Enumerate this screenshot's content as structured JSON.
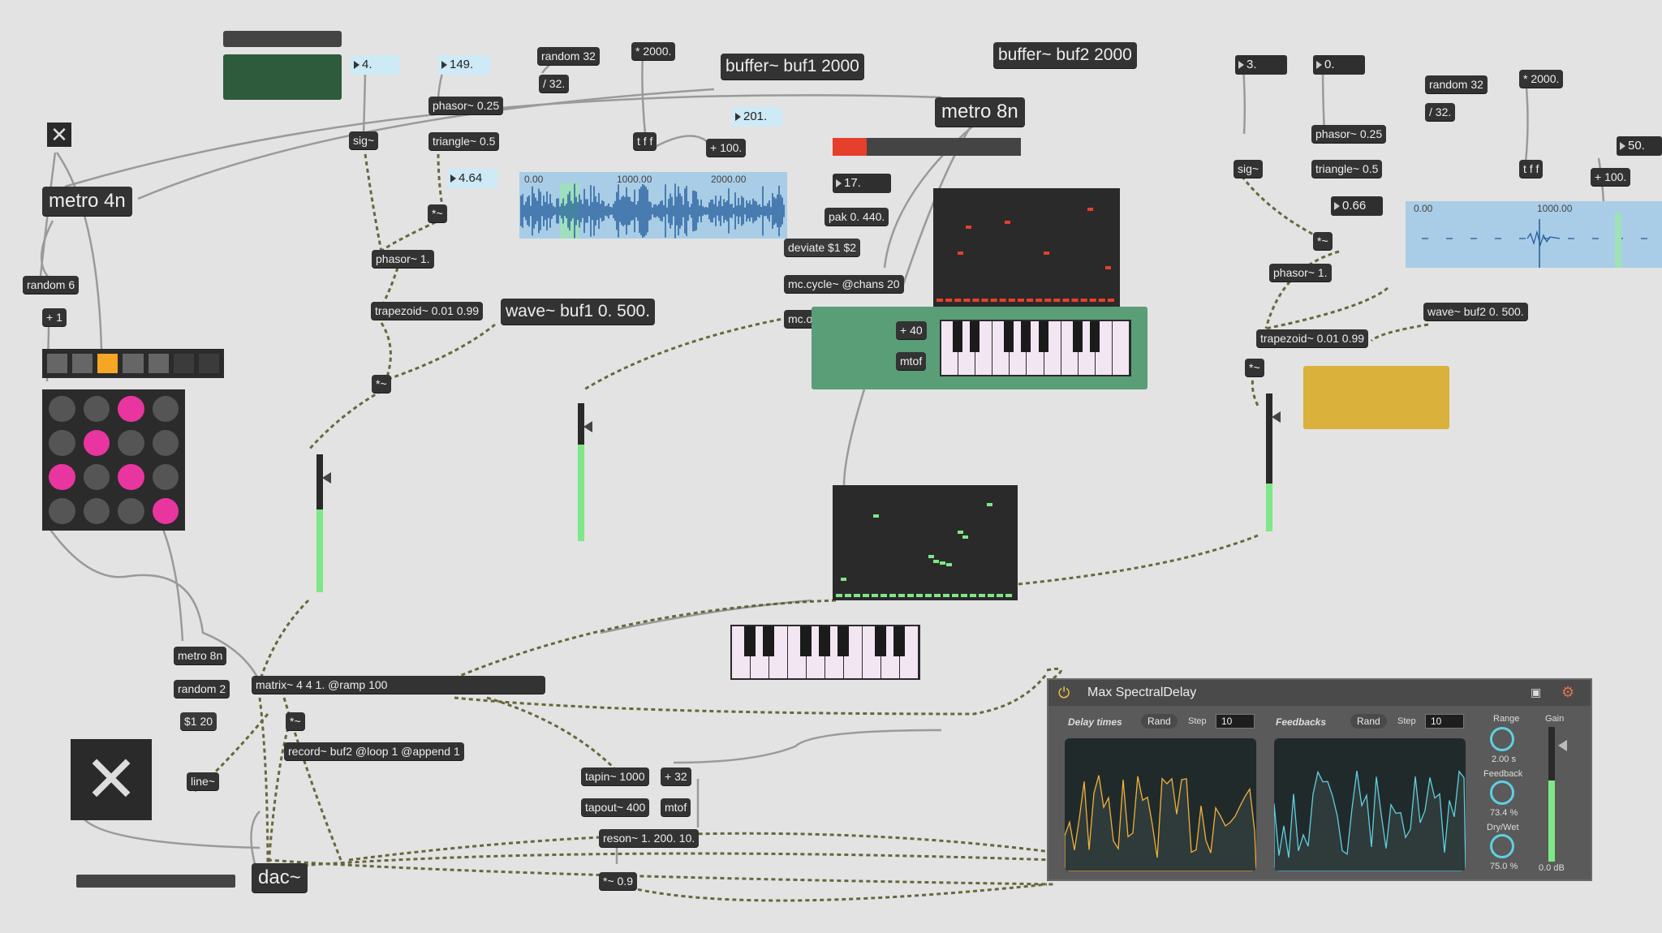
{
  "objects": {
    "metro4n": "metro 4n",
    "random6": "random 6",
    "plus1": "+ 1",
    "sig1": "sig~",
    "phasor025a": "phasor~ 0.25",
    "triangle05a": "triangle~ 0.5",
    "times_a1": "*~",
    "phasor1a": "phasor~ 1.",
    "trapezoid_a": "trapezoid~ 0.01 0.99",
    "times_a2": "*~",
    "random32a": "random 32",
    "div32a": "/ 32.",
    "mul2000a": "* 2000.",
    "tff_a": "t f f",
    "plus100a": "+ 100.",
    "wave1": "wave~ buf1 0. 500.",
    "buffer1": "buffer~ buf1 2000",
    "buffer2": "buffer~ buf2 2000",
    "metro8n_top": "metro 8n",
    "pak": "pak 0. 440.",
    "deviate": "deviate $1 $2",
    "mccycle": "mc.cycle~ @chans 20",
    "mcop": "mc.op~ @op avg",
    "plus40": "+ 40",
    "mtof_top": "mtof",
    "sig2": "sig~",
    "phasor025b": "phasor~ 0.25",
    "triangle05b": "triangle~ 0.5",
    "times_b1": "*~",
    "phasor1b": "phasor~ 1.",
    "trapezoid_b": "trapezoid~ 0.01 0.99",
    "times_b2": "*~",
    "random32b": "random 32",
    "div32b": "/ 32.",
    "mul2000b": "* 2000.",
    "tff_b": "t f f",
    "plus100b": "+ 100.",
    "wave2": "wave~ buf2 0. 500.",
    "metro8n_bot": "metro 8n",
    "random2": "random 2",
    "msg_120": "$1 20",
    "line": "line~",
    "matrix": "matrix~ 4 4 1. @ramp 100",
    "times_m": "*~",
    "record": "record~ buf2 @loop 1 @append 1",
    "tapin": "tapin~ 1000",
    "plus32": "+ 32",
    "tapout": "tapout~ 400",
    "mtof_bot": "mtof",
    "reson": "reson~ 1. 200. 10.",
    "times09": "*~ 0.9",
    "dac": "dac~"
  },
  "numbers": {
    "n4": "4.",
    "n149": "149.",
    "n464": "4.64",
    "n201": "201.",
    "n17": "17.",
    "n3": "3.",
    "n0": "0.",
    "n066": "0.66",
    "n50": "50."
  },
  "waveform1": {
    "ticks": [
      "0.00",
      "1000.00",
      "2000.00"
    ]
  },
  "waveform2": {
    "ticks": [
      "0.00",
      "1000.00"
    ]
  },
  "step_sequencer": {
    "active_step": 3,
    "steps": 7
  },
  "matrix_grid": {
    "rows": [
      [
        0,
        0,
        1,
        0
      ],
      [
        0,
        1,
        0,
        0
      ],
      [
        1,
        0,
        1,
        0
      ],
      [
        0,
        0,
        0,
        1
      ]
    ]
  },
  "spectral_delay": {
    "title": "Max SpectralDelay",
    "delay_times_label": "Delay times",
    "feedbacks_label": "Feedbacks",
    "rand_label": "Rand",
    "step_label": "Step",
    "step_delay": "10",
    "step_feedback": "10",
    "range_label": "Range",
    "range_value": "2.00 s",
    "feedback_label": "Feedback",
    "feedback_value": "73.4 %",
    "drywet_label": "Dry/Wet",
    "drywet_value": "75.0 %",
    "gain_label": "Gain",
    "gain_value": "0.0 dB"
  },
  "meters": {
    "meter1": 0.6,
    "meter2": 0.7,
    "meter3": 0.35,
    "spectral_gain": 0.6
  },
  "colors": {
    "accent_green": "#7ee787",
    "pink": "#e9359f",
    "orange": "#f5a623",
    "mc_green": "#5a9e77",
    "yellow": "#d9b13b",
    "dark_green": "#2e5b3c",
    "wave_blue": "#a9cde6"
  }
}
